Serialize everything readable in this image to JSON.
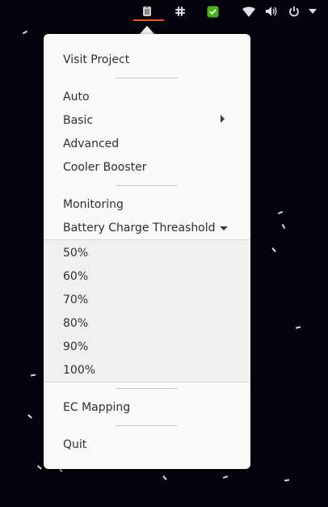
{
  "menu": {
    "visit_project": "Visit Project",
    "auto": "Auto",
    "basic": "Basic",
    "advanced": "Advanced",
    "cooler_booster": "Cooler Booster",
    "monitoring": "Monitoring",
    "battery_threshold": "Battery Charge Threashold",
    "battery_options": [
      "50%",
      "60%",
      "70%",
      "80%",
      "90%",
      "100%"
    ],
    "ec_mapping": "EC Mapping",
    "quit": "Quit"
  },
  "topbar": {
    "icons": [
      "fan-indicator-icon",
      "slack-icon",
      "shield-check-icon",
      "wifi-icon",
      "volume-icon",
      "power-icon",
      "chevron-down-icon"
    ],
    "accent_color": "#e95420",
    "shield_color": "#4caf19"
  }
}
